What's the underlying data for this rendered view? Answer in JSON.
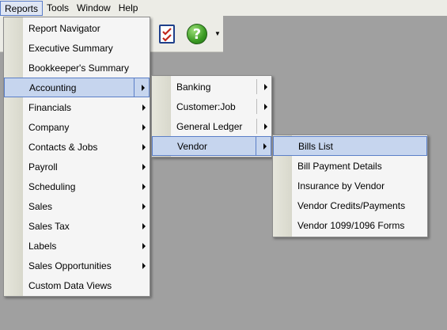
{
  "menubar": {
    "items": [
      {
        "label": "Reports",
        "mnemonic_index": 0
      },
      {
        "label": "Tools",
        "mnemonic_index": 0
      },
      {
        "label": "Window",
        "mnemonic_index": 0
      },
      {
        "label": "Help",
        "mnemonic_index": 0
      }
    ]
  },
  "toolbar": {
    "icons": [
      "checklist-icon",
      "help-icon"
    ]
  },
  "reports_menu": {
    "items": [
      {
        "label": "Report Navigator",
        "submenu": false
      },
      {
        "label": "Executive Summary",
        "submenu": false
      },
      {
        "label": "Bookkeeper's Summary",
        "submenu": false
      },
      {
        "label": "Accounting",
        "submenu": true,
        "highlighted": true
      },
      {
        "label": "Financials",
        "submenu": true
      },
      {
        "label": "Company",
        "submenu": true
      },
      {
        "label": "Contacts & Jobs",
        "submenu": true
      },
      {
        "label": "Payroll",
        "submenu": true
      },
      {
        "label": "Scheduling",
        "submenu": true
      },
      {
        "label": "Sales",
        "submenu": true
      },
      {
        "label": "Sales Tax",
        "submenu": true
      },
      {
        "label": "Labels",
        "submenu": true
      },
      {
        "label": "Sales Opportunities",
        "submenu": true
      },
      {
        "label": "Custom Data Views",
        "submenu": false
      }
    ]
  },
  "accounting_menu": {
    "items": [
      {
        "label": "Banking",
        "submenu": true
      },
      {
        "label": "Customer:Job",
        "submenu": true
      },
      {
        "label": "General Ledger",
        "submenu": true
      },
      {
        "label": "Vendor",
        "submenu": true,
        "highlighted": true
      }
    ]
  },
  "vendor_menu": {
    "items": [
      {
        "label": "Bills List",
        "highlighted": true
      },
      {
        "label": "Bill Payment Details"
      },
      {
        "label": "Insurance by Vendor"
      },
      {
        "label": "Vendor Credits/Payments"
      },
      {
        "label": "Vendor 1099/1096 Forms"
      }
    ]
  },
  "colors": {
    "desktop": "#a0a0a0",
    "menu_bg": "#f5f5f5",
    "highlight_bg": "#c6d5ee",
    "highlight_border": "#5b7fc7"
  }
}
